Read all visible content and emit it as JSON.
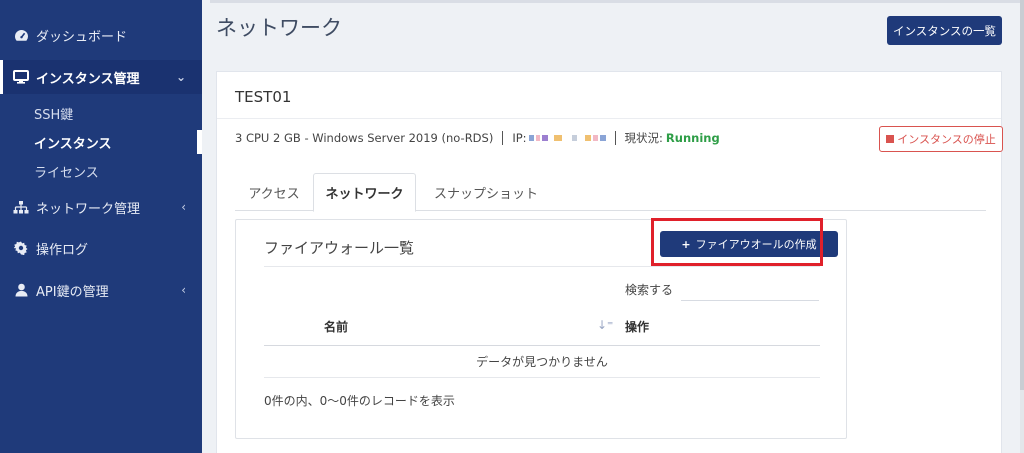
{
  "sidebar": {
    "items": [
      {
        "label": "ダッシュボード",
        "icon": "dashboard-icon"
      },
      {
        "label": "インスタンス管理",
        "icon": "monitor-icon",
        "expanded": true
      },
      {
        "label": "ネットワーク管理",
        "icon": "network-icon"
      },
      {
        "label": "操作ログ",
        "icon": "gear-icon"
      },
      {
        "label": "API鍵の管理",
        "icon": "user-icon"
      }
    ],
    "sub_items": [
      {
        "label": "SSH鍵"
      },
      {
        "label": "インスタンス",
        "current": true
      },
      {
        "label": "ライセンス"
      }
    ]
  },
  "header": {
    "title": "ネットワーク",
    "list_button": "インスタンスの一覧"
  },
  "instance": {
    "name": "TEST01",
    "spec": "3 CPU 2 GB - Windows Server 2019 (no-RDS)",
    "ip_label": "IP:",
    "status_label": "現状況:",
    "status_value": "Running",
    "stop_button": "インスタンスの停止"
  },
  "tabs": [
    {
      "label": "アクセス"
    },
    {
      "label": "ネットワーク",
      "active": true
    },
    {
      "label": "スナップショット"
    }
  ],
  "firewall": {
    "title": "ファイアウォール一覧",
    "create_button": "ファイアウオールの作成",
    "search_label": "検索する",
    "search_value": "",
    "columns": [
      "名前",
      "操作"
    ],
    "empty_message": "データが見つかりません",
    "record_info": "0件の内、0～0件のレコードを表示"
  },
  "colors": {
    "sidebar": "#1f3a7a",
    "primary_button": "#1f3a7a",
    "danger": "#d9534f",
    "running": "#2e9e47",
    "highlight": "#e0202a"
  }
}
